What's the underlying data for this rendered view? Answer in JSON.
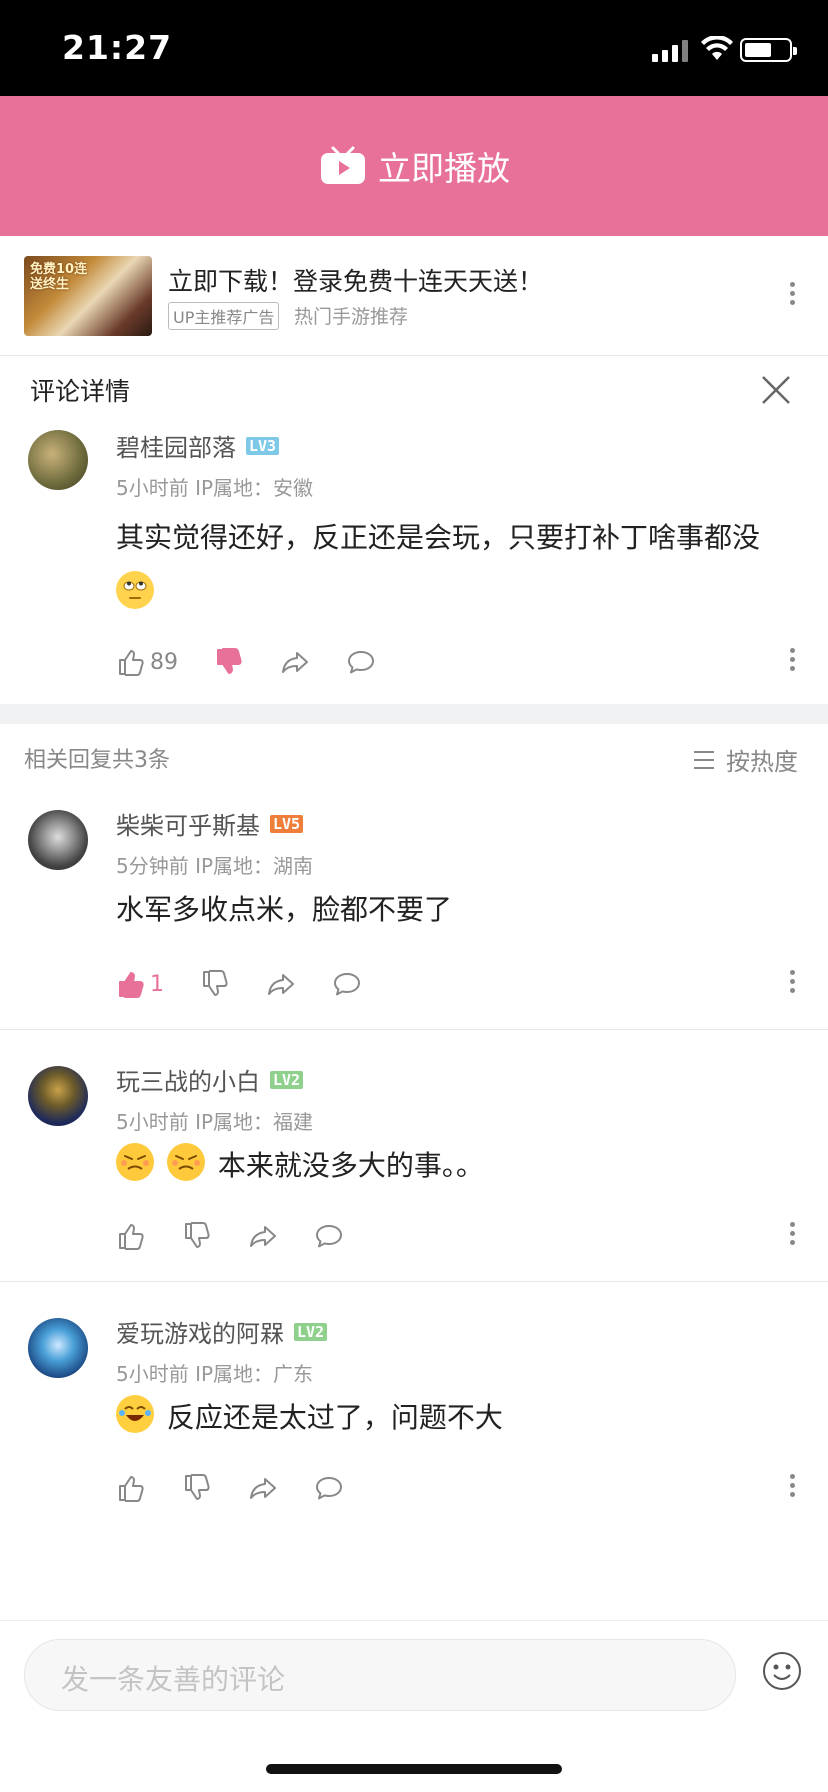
{
  "status": {
    "time": "21:27"
  },
  "banner": {
    "play_label": "立即播放"
  },
  "ad": {
    "thumb_text": "免费10连\n送终生",
    "title": "立即下载！登录免费十连天天送！",
    "tag": "UP主推荐广告",
    "subtitle": "热门手游推荐"
  },
  "detail": {
    "title": "评论详情"
  },
  "main_comment": {
    "user": "碧桂园部落",
    "level": "LV3",
    "meta": "5小时前  IP属地：安徽",
    "text": "其实觉得还好，反正还是会玩，只要打补丁啥事都没",
    "likes": "89"
  },
  "replies_header": {
    "count_label": "相关回复共3条",
    "sort_label": "按热度"
  },
  "replies": [
    {
      "user": "柴柴可乎斯基",
      "level": "LV5",
      "meta": "5分钟前  IP属地：湖南",
      "text": "水军多收点米，脸都不要了",
      "likes": "1"
    },
    {
      "user": "玩三战的小白",
      "level": "LV2",
      "meta": "5小时前  IP属地：福建",
      "text": "本来就没多大的事。。"
    },
    {
      "user": "爱玩游戏的阿槑",
      "level": "LV2",
      "meta": "5小时前  IP属地：广东",
      "text": "反应还是太过了，问题不大"
    }
  ],
  "input": {
    "placeholder": "发一条友善的评论"
  },
  "colors": {
    "brand_pink": "#e8719a",
    "lv2": "#8fd18c",
    "lv3": "#7ec8e8",
    "lv5": "#ee7e3a"
  }
}
